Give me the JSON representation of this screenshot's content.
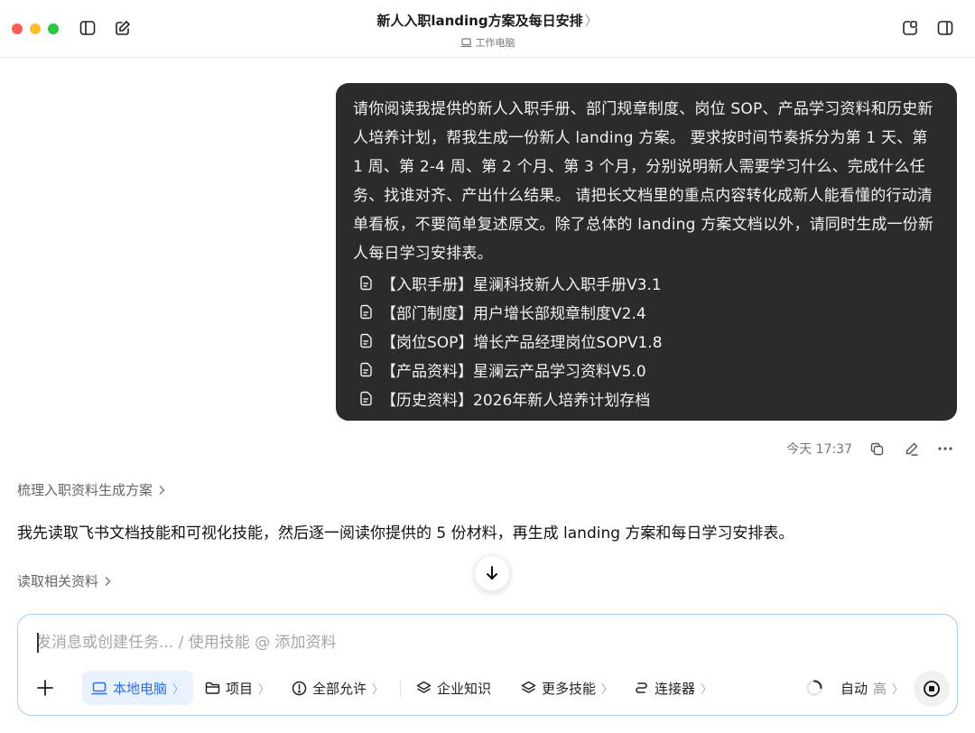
{
  "window": {
    "title": "新人入职landing方案及每日安排",
    "title_chevron": "〉",
    "device": "工作电脑"
  },
  "message": {
    "text": "请你阅读我提供的新人入职手册、部门规章制度、岗位 SOP、产品学习资料和历史新人培养计划，帮我生成一份新人 landing 方案。 要求按时间节奏拆分为第 1 天、第 1 周、第 2-4 周、第 2 个月、第 3 个月，分别说明新人需要学习什么、完成什么任务、找谁对齐、产出什么结果。 请把长文档里的重点内容转化成新人能看懂的行动清单看板，不要简单复述原文。除了总体的 landing 方案文档以外，请同时生成一份新人每日学习安排表。",
    "attachments": [
      "【入职手册】星澜科技新人入职手册V3.1",
      "【部门制度】用户增长部规章制度V2.4",
      "【岗位SOP】增长产品经理岗位SOPV1.8",
      "【产品资料】星澜云产品学习资料V5.0",
      "【历史资料】2026年新人培养计划存档"
    ],
    "timestamp": "今天 17:37"
  },
  "response": {
    "step1": "梳理入职资料生成方案",
    "answer": "我先读取飞书文档技能和可视化技能，然后逐一阅读你提供的 5 份材料，再生成 landing 方案和每日学习安排表。",
    "step2": "读取相关资料"
  },
  "composer": {
    "placeholder": "发消息或创建任务... / 使用技能 @ 添加资料",
    "tools": {
      "local": "本地电脑",
      "project": "项目",
      "permission": "全部允许",
      "knowledge": "企业知识",
      "skills": "更多技能",
      "connector": "连接器"
    },
    "mode": "自动",
    "level": "高",
    "chevron": "〉"
  },
  "icons": {
    "sidebar": "sidebar-icon",
    "compose": "compose-icon",
    "laptop": "laptop-icon",
    "doc": "document-icon",
    "copy": "copy-icon",
    "edit": "edit-icon",
    "more": "more-icon",
    "arrow_down": "arrow-down-icon",
    "plus": "plus-icon",
    "folder": "folder-icon",
    "shield": "alert-icon",
    "layers": "layers-icon",
    "link": "link-icon",
    "spinner": "spinner-icon",
    "stop": "stop-icon"
  },
  "colors": {
    "bubble": "#2b2b2b",
    "accent": "#2f6fe4",
    "composer_border": "#a9ccf7"
  }
}
